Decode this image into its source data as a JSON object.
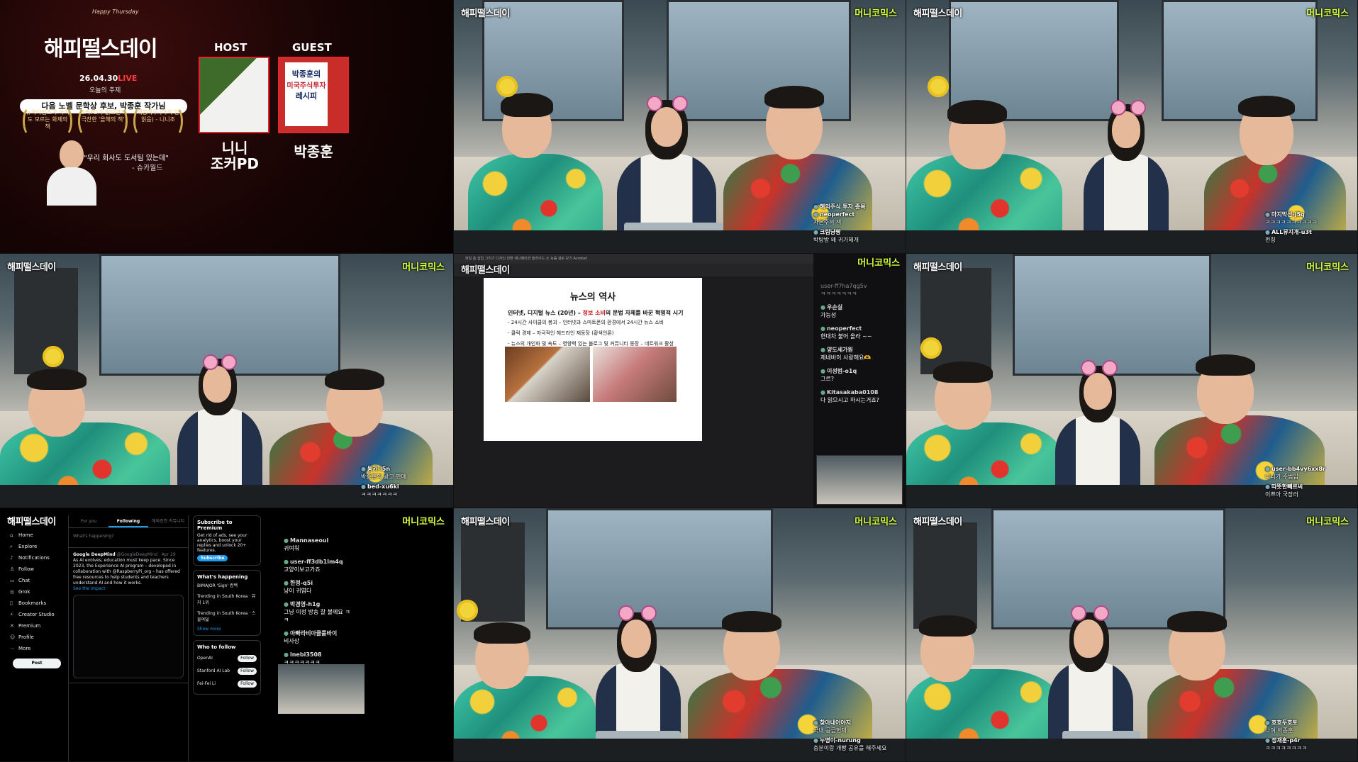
{
  "watermark": "해피떨스데이",
  "brand": "머니코믹스",
  "poster": {
    "title_en": "Happy Thursday",
    "title": "해피떨스데이",
    "date": "26.04.30",
    "live": "LIVE",
    "sub": "오늘의 주제",
    "topic": "다음 노벨 문학상 후보, 박종훈 작가님",
    "laurels": [
      "뉴욕타임즈가 아직도 모르는 화제의 책",
      "조커PD가 읽으면서 극찬한 '올해의 책'",
      "개봉박두 (아직 안읽음) - 니니조"
    ],
    "quote": "\"우리 회사도 도서팀 있는데\"",
    "quote_author": "- 슈카월드",
    "host_label": "HOST",
    "guest_label": "GUEST",
    "host_name": "니니\n조커PD",
    "guest_name": "박종훈",
    "book_author": "박종훈의",
    "book_title": "미국주식투자",
    "book_sub": "레시피"
  },
  "cells": {
    "c2_chat": [
      {
        "user": "해외주식 투자 종목",
        "msg": ""
      },
      {
        "user": "neoperfect",
        "msg": "자본주의 책"
      },
      {
        "user": "크림냥짱",
        "msg": "박탕방 왜 귀가해개"
      }
    ],
    "c3_chat": [
      {
        "user": "마지막선-j5q",
        "msg": "ㅋㅋㅋㅋㅋㅋㅋㅋㅋㅋ"
      },
      {
        "user": "ALL뮤지개-u3t",
        "msg": "펀칭"
      }
    ],
    "c4_chat": [
      {
        "user": "동카-l5n",
        "msg": "박종훈의 광고 판매"
      },
      {
        "user": "bed-xu6kl",
        "msg": "ㅋㅋㅋㅋㅋㅋㅋ"
      }
    ],
    "c6_chat": [
      {
        "user": "user-bb4vy6xx8r",
        "msg": "나니가 주범임"
      },
      {
        "user": "따뜻한빼르씨",
        "msg": "이쁘아 국장러"
      }
    ],
    "c8_chat": [
      {
        "user": "찾아내어야지",
        "msg": "국내 공급현재"
      },
      {
        "user": "누명이-nurung",
        "msg": "충분이랑 개빵 공유를 해주세요"
      }
    ],
    "c9_chat": [
      {
        "user": "호호두호토",
        "msg": "나여 박종훈"
      },
      {
        "user": "정재훈-p4r",
        "msg": "ㅋㅋㅋㅋㅋㅋㅋㅋ"
      }
    ]
  },
  "slide": {
    "menu": "파일  홈  삽입  그리기  디자인  전환  애니메이션  슬라이드 쇼  녹음  검토  보기  Acrobat",
    "title": "뉴스의 역사",
    "lead_a": "인터넷, 디지털 뉴스 (20년) – ",
    "lead_hl": "정보 소비",
    "lead_b": "의 문법 자체를 바꾼 혁명적 시기",
    "bullets": [
      "24시간 사이클의 붕괴 – 인터넷과 스마트폰의 환경에서 24시간 뉴스 소비",
      "클릭 경제 – 자극적인 헤드라인 재등장 (황색언론)",
      "뉴스의 개인화 및 속도 – 영향력 있는 블로그 및 커뮤니티 등장 – 네트워크 활성"
    ],
    "chat_first": "user-ff7ha7qg5v",
    "chat_first_msg": "ㅋㅋㅋㅋㅋㅋㅋ",
    "chat": [
      {
        "user": "우손실",
        "msg": "가능성"
      },
      {
        "user": "neoperfect",
        "msg": "현대차 불어 올라 ~~"
      },
      {
        "user": "양도세가원",
        "msg": "제네바이 사랑해요🫶"
      },
      {
        "user": "이성범-o1q",
        "msg": "그르?"
      },
      {
        "user": "Kitasakaba0108",
        "msg": "다 읽으시고 하시는거죠?"
      }
    ]
  },
  "xfeed": {
    "nav": [
      {
        "icon": "home-icon",
        "glyph": "⌂",
        "label": "Home"
      },
      {
        "icon": "search-icon",
        "glyph": "⌕",
        "label": "Explore"
      },
      {
        "icon": "bell-icon",
        "glyph": "♪",
        "label": "Notifications"
      },
      {
        "icon": "follow-icon",
        "glyph": "♙",
        "label": "Follow"
      },
      {
        "icon": "chat-icon",
        "glyph": "▭",
        "label": "Chat"
      },
      {
        "icon": "grok-icon",
        "glyph": "◎",
        "label": "Grok"
      },
      {
        "icon": "bookmark-icon",
        "glyph": "▯",
        "label": "Bookmarks"
      },
      {
        "icon": "bolt-icon",
        "glyph": "⚡",
        "label": "Creator Studio"
      },
      {
        "icon": "x-icon",
        "glyph": "✕",
        "label": "Premium"
      },
      {
        "icon": "profile-icon",
        "glyph": "☺",
        "label": "Profile"
      },
      {
        "icon": "more-icon",
        "glyph": "⋯",
        "label": "More"
      }
    ],
    "post": "Post",
    "tabs": [
      "For you",
      "Following",
      "해외증권 커뮤니티"
    ],
    "compose": "What's happening?",
    "tweet_name": "Google DeepMind",
    "tweet_handle": "@GoogleDeepMind · Apr 29",
    "tweet_text": "As AI evolves, education must keep pace. Since 2023, the Experience AI program – developed in collaboration with @RaspberryPi_org – has offered free resources to help students and teachers understand AI and how it works.",
    "tweet_link": "See the impact",
    "subscribe_title": "Subscribe to Premium",
    "subscribe_text": "Get rid of ads, see your analytics, boost your replies and unlock 20+ features.",
    "subscribe_btn": "Subscribe",
    "happening_title": "What's happening",
    "happening": [
      "BIMAJOR 'Sign' 컴백",
      "Trending in South Korea · 뮤지 1위",
      "Trending in South Korea · 스물여덟"
    ],
    "show_more": "Show more",
    "follow_title": "Who to follow",
    "follow": [
      "OpenAI",
      "Stanford AI Lab",
      "Fei-Fei Li"
    ],
    "follow_btn": "Follow",
    "chat": [
      {
        "user": "Mannaseoul",
        "msg": "귀여워"
      },
      {
        "user": "user-ff3db1lm4q",
        "msg": "고양이보고가죠"
      },
      {
        "user": "한정-q5i",
        "msg": "냥이 귀엽다"
      },
      {
        "user": "박경영-h1g",
        "msg": "그냥 이정 방송 잘 볼께요 ㅋㅋ"
      },
      {
        "user": "아빠라비아클룰바이",
        "msg": "비사상"
      },
      {
        "user": "lnebi3508",
        "msg": "ㅋㅋㅋㅋㅋㅋㅋ"
      }
    ]
  }
}
